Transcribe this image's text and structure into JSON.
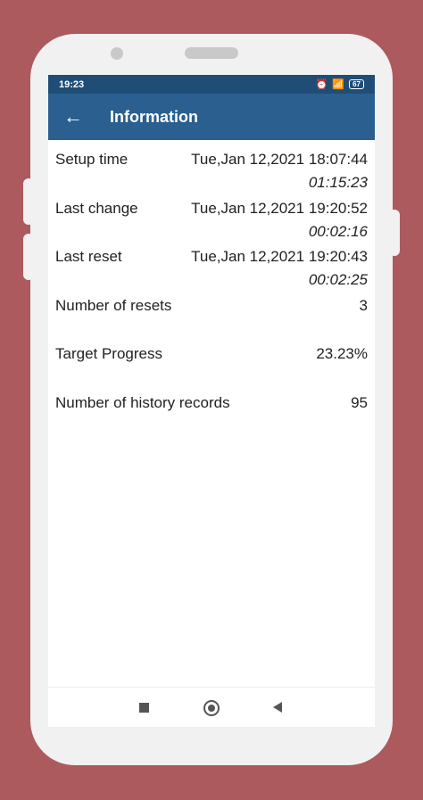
{
  "status": {
    "time": "19:23",
    "battery": "67"
  },
  "appbar": {
    "title": "Information"
  },
  "info": {
    "setup_label": "Setup time",
    "setup_date": "Tue,Jan 12,2021 18:07:44",
    "setup_duration": "01:15:23",
    "change_label": "Last change",
    "change_date": "Tue,Jan 12,2021 19:20:52",
    "change_duration": "00:02:16",
    "reset_label": "Last reset",
    "reset_date": "Tue,Jan 12,2021 19:20:43",
    "reset_duration": "00:02:25",
    "resets_label": "Number of resets",
    "resets_value": "3",
    "progress_label": "Target Progress",
    "progress_value": "23.23%",
    "history_label": "Number of history records",
    "history_value": "95"
  },
  "colors": {
    "background": "#ad5a5e",
    "statusbar": "#1f4d75",
    "appbar": "#2a5f8f"
  }
}
